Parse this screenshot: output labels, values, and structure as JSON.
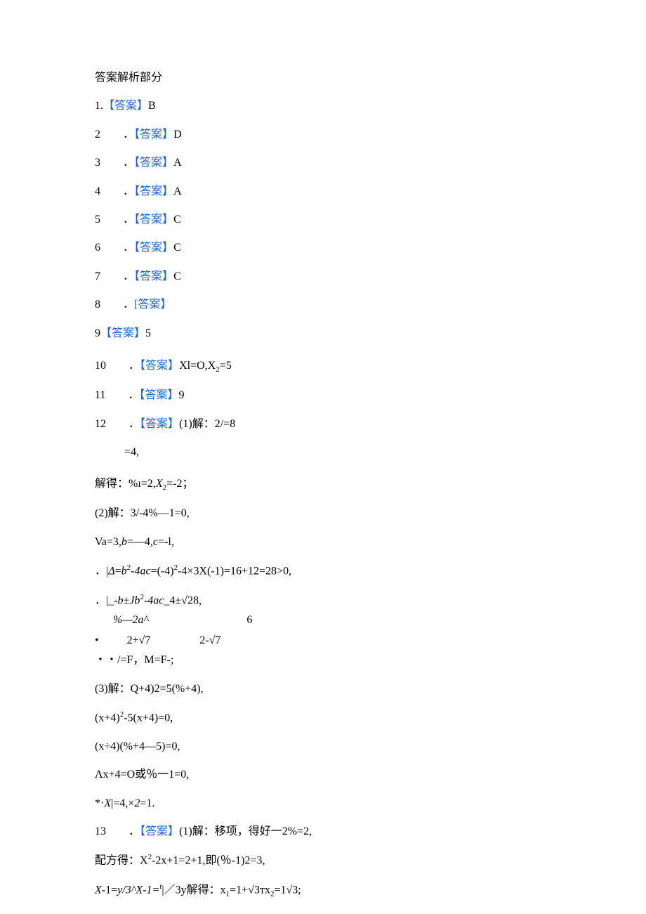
{
  "title": "答案解析部分",
  "answer_label": "答案",
  "answer_label_alt": "[答案】",
  "items": {
    "a1": {
      "num": "1.",
      "val": "B"
    },
    "a2": {
      "num": "2",
      "dot": "．",
      "val": "D"
    },
    "a3": {
      "num": "3",
      "dot": "．",
      "val": "A"
    },
    "a4": {
      "num": "4",
      "dot": "．",
      "val": "A"
    },
    "a5": {
      "num": "5",
      "dot": "．",
      "val": "C"
    },
    "a6": {
      "num": "6",
      "dot": "．",
      "val": "C"
    },
    "a7": {
      "num": "7",
      "dot": "．",
      "val": "C"
    },
    "a8": {
      "num": "8",
      "dot": "．",
      "val": ""
    },
    "a9": {
      "num": "9",
      "val": "5"
    },
    "a10": {
      "num": "10",
      "dot": "．",
      "val_pre": "Xl=O,X",
      "val_sub": "2",
      "val_post": "=5"
    },
    "a11": {
      "num": "11",
      "dot": "．",
      "val": "9"
    },
    "a12": {
      "num": "12",
      "dot": "．",
      "val": "(1)解：2/=8"
    },
    "a12b": "=4,",
    "l_solve1_pre": "解得：%ı=2,",
    "l_solve1_x": "X",
    "l_solve1_sub": "2",
    "l_solve1_post": "=-2；",
    "l_2": "(2)解：3/-4%—1=0,",
    "l_va_pre": "Va=3,",
    "l_va_b": "b",
    "l_va_post": "=—4,c=-l,",
    "l_delta_pre": "．|",
    "l_delta_d": "Δ",
    "l_delta_eq": "=",
    "l_delta_b2": "b",
    "l_delta_p2": "2",
    "l_delta_m": "-4ac",
    "l_delta_post": "=(-4)",
    "l_delta_s2": "2",
    "l_delta_tail": "-4×3X(-1)=16+12=28>0,",
    "l_frac_top_pre": "．|_",
    "l_frac_top_b": "-b±Jb",
    "l_frac_top_s": "2",
    "l_frac_top_m": "-4ac",
    "l_frac_top_post": "_4±√28,",
    "l_frac_bot_pre": "%—2a^",
    "l_frac_bot_6": "6",
    "l_bul": "•",
    "l_27a": "2+√7",
    "l_27b": "2-√7",
    "l_fm": "・・/=F，M=F-;",
    "l_3": "(3)解：Q+4)2=5(%+4),",
    "l_x4a_pre": "(x+4)",
    "l_x4a_s": "2",
    "l_x4a_post": "-5(x+4)=0,",
    "l_x4b": "(x÷4)(%+4—5)=0,",
    "l_lx": "Λx+4=O或％一1=0,",
    "l_star_pre": "*·",
    "l_star_x": "X",
    "l_star_mid": "|=4,×",
    "l_star_2": "2",
    "l_star_post": "=1.",
    "a13": {
      "num": "13",
      "dot": "．",
      "val": "(1)解：移项，得好一2%=2,"
    },
    "l_pf_pre": "配方得：X",
    "l_pf_s": "2",
    "l_pf_post": "-2x+1=2+1,即(％-1)2=3,",
    "l_last_pre": "X",
    "l_last_mid1": "-1=",
    "l_last_y": "y/3^X-1=",
    "l_last_t": "t",
    "l_last_mid2": "|／3y",
    "l_last_solve": "解得：x",
    "l_last_s1": "1",
    "l_last_eq1": "=1+√3тx",
    "l_last_s2": "2",
    "l_last_eq2": "=1√3;"
  }
}
